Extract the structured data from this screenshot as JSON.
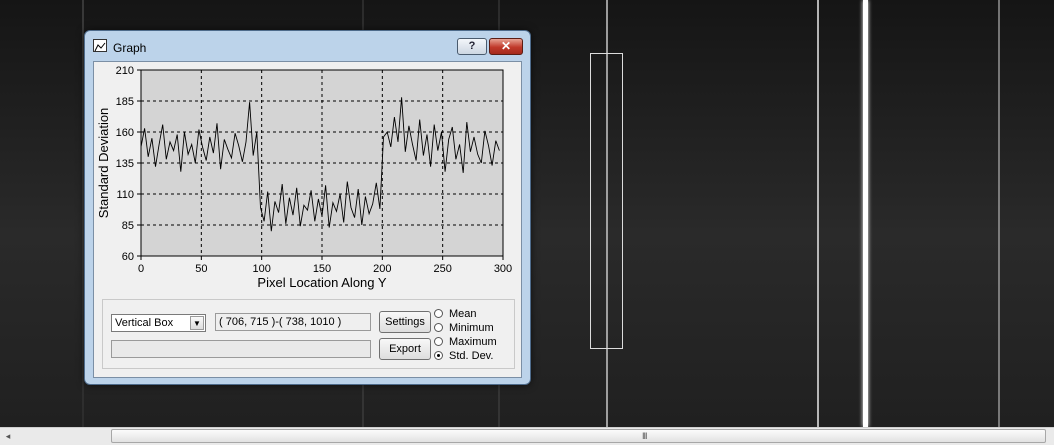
{
  "window": {
    "title": "Graph",
    "help_label": "?",
    "close_label": "✕",
    "icon": "graph-icon"
  },
  "controls": {
    "mode_options": [
      "Vertical Box"
    ],
    "mode_selected": "Vertical Box",
    "coordinates": "( 706, 715 )-( 738, 1010 )",
    "status_text": "",
    "settings_label": "Settings",
    "export_label": "Export",
    "stat_options": [
      {
        "label": "Mean",
        "checked": false
      },
      {
        "label": "Minimum",
        "checked": false
      },
      {
        "label": "Maximum",
        "checked": false
      },
      {
        "label": "Std. Dev.",
        "checked": true
      }
    ]
  },
  "scrollbar": {
    "left_arrow": "◂",
    "grip": "III"
  },
  "colors": {
    "plot_bg": "#d4d4d4",
    "line": "#000000",
    "dialog_frame": "#bcd3ea"
  },
  "chart_data": {
    "type": "line",
    "xlabel": "Pixel Location Along Y",
    "ylabel": "Standard Deviation",
    "xlim": [
      0,
      300
    ],
    "ylim": [
      60,
      210
    ],
    "xticks": [
      0,
      50,
      100,
      150,
      200,
      250,
      300
    ],
    "yticks": [
      60,
      85,
      110,
      135,
      160,
      185,
      210
    ],
    "grid": true,
    "series": [
      {
        "x_start": 0,
        "x_step": 3,
        "values": [
          148,
          163,
          140,
          155,
          132,
          150,
          166,
          138,
          152,
          145,
          158,
          128,
          160,
          142,
          150,
          135,
          162,
          148,
          137,
          156,
          143,
          167,
          130,
          154,
          146,
          139,
          159,
          149,
          136,
          152,
          184,
          141,
          160,
          99,
          88,
          112,
          80,
          104,
          95,
          118,
          86,
          107,
          93,
          115,
          84,
          101,
          97,
          113,
          88,
          106,
          92,
          117,
          83,
          103,
          96,
          110,
          87,
          120,
          99,
          91,
          114,
          85,
          108,
          94,
          102,
          119,
          98,
          156,
          160,
          148,
          172,
          152,
          188,
          144,
          165,
          150,
          137,
          170,
          141,
          158,
          132,
          166,
          145,
          160,
          128,
          154,
          164,
          138,
          150,
          127,
          168,
          144,
          156,
          142,
          135,
          161,
          149,
          133,
          153,
          145
        ]
      }
    ]
  }
}
